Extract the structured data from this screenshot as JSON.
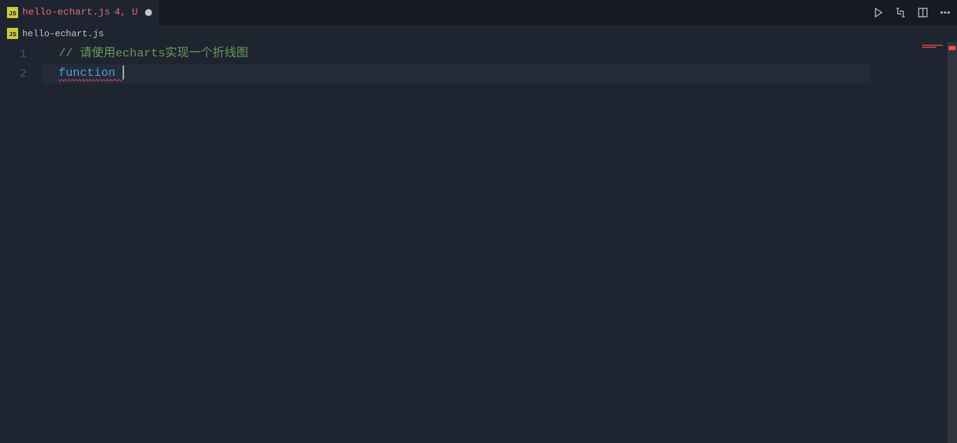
{
  "tab": {
    "filename": "hello-echart.js",
    "status": "4, U",
    "dirty": true
  },
  "breadcrumb": {
    "filename": "hello-echart.js"
  },
  "editor": {
    "lines": [
      {
        "num": "1",
        "comment_slash": "// ",
        "comment_text": "请使用echarts实现一个折线图"
      },
      {
        "num": "2",
        "keyword": "function"
      }
    ],
    "active_line_index": 1
  }
}
